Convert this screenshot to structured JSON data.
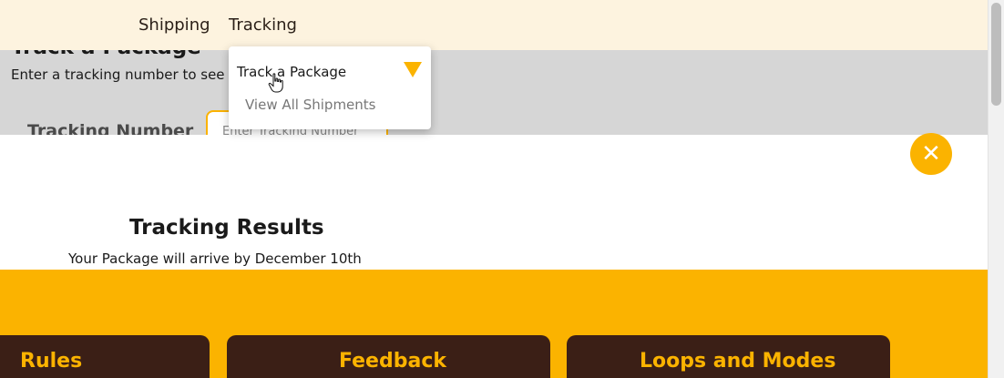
{
  "nav": {
    "items": [
      {
        "label": "Shipping"
      },
      {
        "label": "Tracking"
      }
    ]
  },
  "dropdown": {
    "items": [
      {
        "label": "Track a Package"
      },
      {
        "label": "View All Shipments"
      }
    ],
    "arrow_icon": "triangle-down-icon"
  },
  "track_section": {
    "heading": "Track a Package",
    "subtitle": "Enter a tracking number to see",
    "field_label": "Tracking Number",
    "input_placeholder": "Enter Tracking Number"
  },
  "modal": {
    "close_icon": "close-icon",
    "title": "Tracking Results",
    "subtitle": "Your Package will arrive by December 10th"
  },
  "footer": {
    "cards": [
      {
        "title": "Rules"
      },
      {
        "title": "Feedback"
      },
      {
        "title": "Loops and Modes"
      }
    ]
  },
  "colors": {
    "accent": "#fbb300",
    "nav_bg": "#fdf3df",
    "section_bg": "#d6d6d6",
    "card_bg": "#3b1f16"
  }
}
